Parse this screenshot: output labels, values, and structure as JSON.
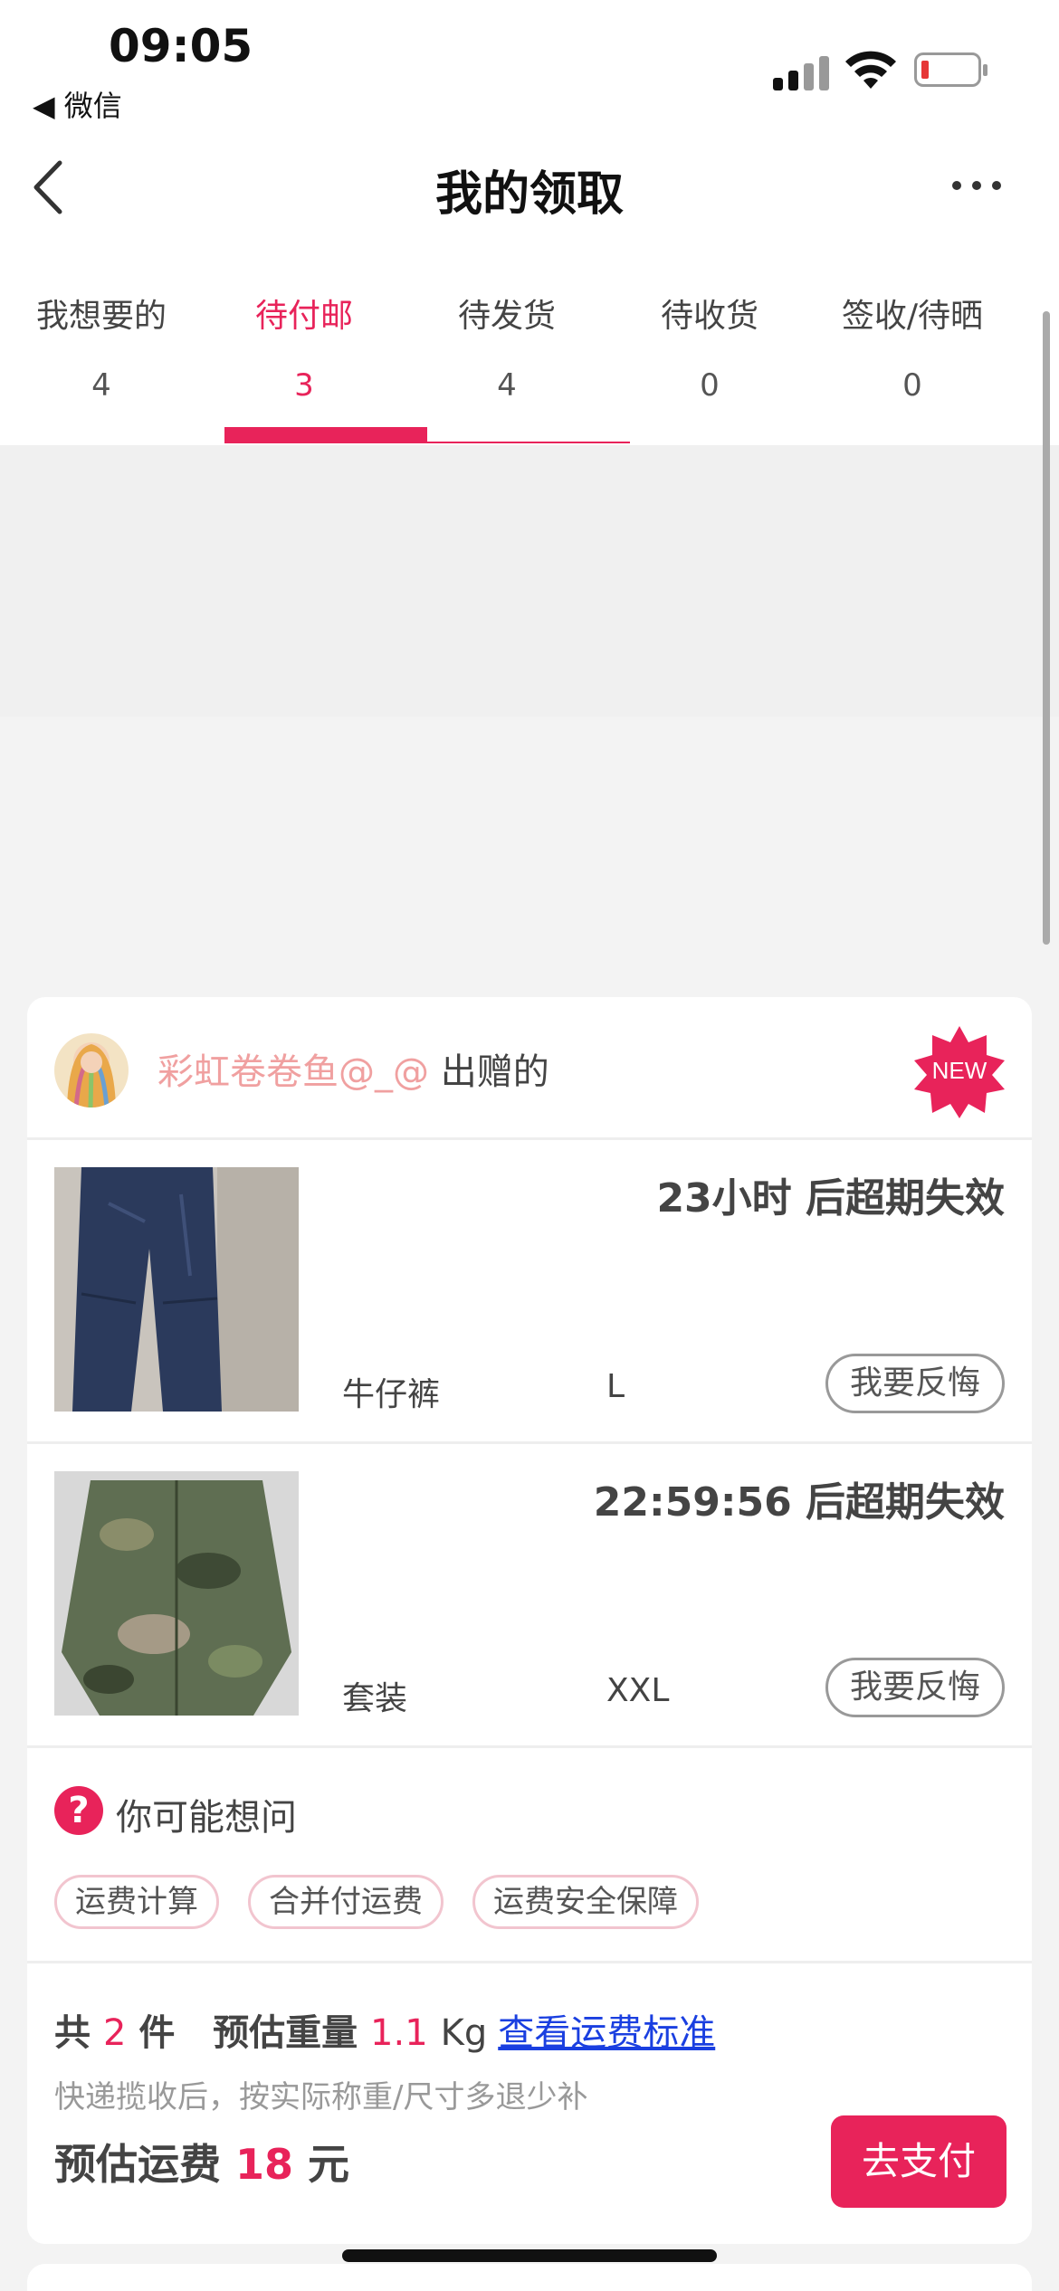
{
  "status_bar": {
    "time": "09:05",
    "back_app": "◀ 微信"
  },
  "nav": {
    "title": "我的领取"
  },
  "tabs": [
    {
      "label": "我想要的",
      "count": "4"
    },
    {
      "label": "待付邮",
      "count": "3"
    },
    {
      "label": "待发货",
      "count": "4"
    },
    {
      "label": "待收货",
      "count": "0"
    },
    {
      "label": "签收/待晒",
      "count": "0"
    }
  ],
  "card": {
    "donor_name": "彩虹卷卷鱼@_@",
    "donor_suffix": " 出赠的",
    "new_badge": "NEW",
    "items": [
      {
        "timer": "23小时 后超期失效",
        "name": "牛仔裤",
        "size": "L",
        "action": "我要反悔"
      },
      {
        "timer": "22:59:56 后超期失效",
        "name": "套装",
        "size": "XXL",
        "action": "我要反悔"
      }
    ],
    "faq": {
      "icon": "?",
      "title": "你可能想问",
      "chips": [
        "运费计算",
        "合并付运费",
        "运费安全保障"
      ]
    },
    "summary": {
      "total_prefix": "共",
      "total_count": "2",
      "total_suffix": "件",
      "weight_label": "预估重量",
      "weight_value": "1.1",
      "weight_unit": "Kg",
      "link": "查看运费标准",
      "note": "快递揽收后，按实际称重/尺寸多退少补",
      "fee_label": "预估运费",
      "fee_value": "18",
      "fee_unit": "元",
      "pay_button": "去支付"
    }
  },
  "colors": {
    "accent": "#e8235a",
    "link": "#1a3fe0"
  }
}
